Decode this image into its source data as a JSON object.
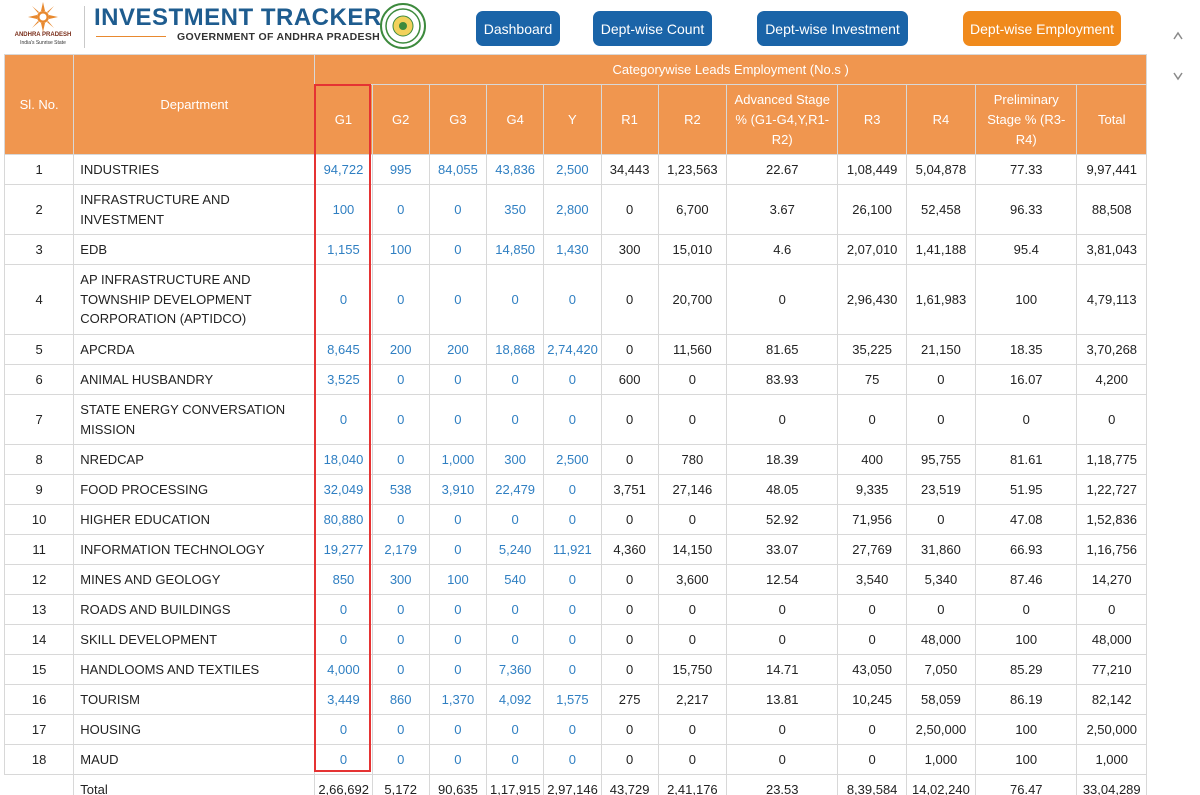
{
  "logo": {
    "state_name": "ANDHRA PRADESH",
    "tagline": "India's Sunrise State"
  },
  "header": {
    "title": "INVESTMENT TRACKER",
    "subtitle": "GOVERNMENT OF ANDHRA PRADESH"
  },
  "nav": [
    {
      "label": "Dashboard",
      "active": false
    },
    {
      "label": "Dept-wise Count",
      "active": false
    },
    {
      "label": "Dept-wise Investment",
      "active": false
    },
    {
      "label": "Dept-wise Employment",
      "active": true
    }
  ],
  "colors": {
    "header_orange": "#f0964f",
    "nav_blue": "#1a64a8",
    "nav_active": "#f08a1c",
    "link_blue": "#2f7fc2",
    "highlight_red": "#e53333",
    "title_blue": "#1e5c8f"
  },
  "table": {
    "group_header": "Categorywise Leads Employment (No.s )",
    "col_slno": "Sl. No.",
    "col_department": "Department",
    "columns": [
      "G1",
      "G2",
      "G3",
      "G4",
      "Y",
      "R1",
      "R2",
      "Advanced Stage % (G1-G4,Y,R1-R2)",
      "R3",
      "R4",
      "Preliminary Stage % (R3-R4)",
      "Total"
    ],
    "rows": [
      {
        "sl": "1",
        "dept": "INDUSTRIES",
        "values": [
          "94,722",
          "995",
          "84,055",
          "43,836",
          "2,500",
          "34,443",
          "1,23,563",
          "22.67",
          "1,08,449",
          "5,04,878",
          "77.33",
          "9,97,441"
        ]
      },
      {
        "sl": "2",
        "dept": "INFRASTRUCTURE AND INVESTMENT",
        "values": [
          "100",
          "0",
          "0",
          "350",
          "2,800",
          "0",
          "6,700",
          "3.67",
          "26,100",
          "52,458",
          "96.33",
          "88,508"
        ]
      },
      {
        "sl": "3",
        "dept": "EDB",
        "values": [
          "1,155",
          "100",
          "0",
          "14,850",
          "1,430",
          "300",
          "15,010",
          "4.6",
          "2,07,010",
          "1,41,188",
          "95.4",
          "3,81,043"
        ]
      },
      {
        "sl": "4",
        "dept": "AP INFRASTRUCTURE AND TOWNSHIP DEVELOPMENT CORPORATION (APTIDCO)",
        "values": [
          "0",
          "0",
          "0",
          "0",
          "0",
          "0",
          "20,700",
          "0",
          "2,96,430",
          "1,61,983",
          "100",
          "4,79,113"
        ]
      },
      {
        "sl": "5",
        "dept": "APCRDA",
        "values": [
          "8,645",
          "200",
          "200",
          "18,868",
          "2,74,420",
          "0",
          "11,560",
          "81.65",
          "35,225",
          "21,150",
          "18.35",
          "3,70,268"
        ]
      },
      {
        "sl": "6",
        "dept": "ANIMAL HUSBANDRY",
        "values": [
          "3,525",
          "0",
          "0",
          "0",
          "0",
          "600",
          "0",
          "83.93",
          "75",
          "0",
          "16.07",
          "4,200"
        ]
      },
      {
        "sl": "7",
        "dept": "STATE ENERGY CONVERSATION MISSION",
        "values": [
          "0",
          "0",
          "0",
          "0",
          "0",
          "0",
          "0",
          "0",
          "0",
          "0",
          "0",
          "0"
        ]
      },
      {
        "sl": "8",
        "dept": "NREDCAP",
        "values": [
          "18,040",
          "0",
          "1,000",
          "300",
          "2,500",
          "0",
          "780",
          "18.39",
          "400",
          "95,755",
          "81.61",
          "1,18,775"
        ]
      },
      {
        "sl": "9",
        "dept": "FOOD PROCESSING",
        "values": [
          "32,049",
          "538",
          "3,910",
          "22,479",
          "0",
          "3,751",
          "27,146",
          "48.05",
          "9,335",
          "23,519",
          "51.95",
          "1,22,727"
        ]
      },
      {
        "sl": "10",
        "dept": "HIGHER EDUCATION",
        "values": [
          "80,880",
          "0",
          "0",
          "0",
          "0",
          "0",
          "0",
          "52.92",
          "71,956",
          "0",
          "47.08",
          "1,52,836"
        ]
      },
      {
        "sl": "11",
        "dept": "INFORMATION TECHNOLOGY",
        "values": [
          "19,277",
          "2,179",
          "0",
          "5,240",
          "11,921",
          "4,360",
          "14,150",
          "33.07",
          "27,769",
          "31,860",
          "66.93",
          "1,16,756"
        ]
      },
      {
        "sl": "12",
        "dept": "MINES AND GEOLOGY",
        "values": [
          "850",
          "300",
          "100",
          "540",
          "0",
          "0",
          "3,600",
          "12.54",
          "3,540",
          "5,340",
          "87.46",
          "14,270"
        ]
      },
      {
        "sl": "13",
        "dept": "ROADS AND BUILDINGS",
        "values": [
          "0",
          "0",
          "0",
          "0",
          "0",
          "0",
          "0",
          "0",
          "0",
          "0",
          "0",
          "0"
        ]
      },
      {
        "sl": "14",
        "dept": "SKILL DEVELOPMENT",
        "values": [
          "0",
          "0",
          "0",
          "0",
          "0",
          "0",
          "0",
          "0",
          "0",
          "48,000",
          "100",
          "48,000"
        ]
      },
      {
        "sl": "15",
        "dept": "HANDLOOMS AND TEXTILES",
        "values": [
          "4,000",
          "0",
          "0",
          "7,360",
          "0",
          "0",
          "15,750",
          "14.71",
          "43,050",
          "7,050",
          "85.29",
          "77,210"
        ]
      },
      {
        "sl": "16",
        "dept": "TOURISM",
        "values": [
          "3,449",
          "860",
          "1,370",
          "4,092",
          "1,575",
          "275",
          "2,217",
          "13.81",
          "10,245",
          "58,059",
          "86.19",
          "82,142"
        ]
      },
      {
        "sl": "17",
        "dept": "HOUSING",
        "values": [
          "0",
          "0",
          "0",
          "0",
          "0",
          "0",
          "0",
          "0",
          "0",
          "2,50,000",
          "100",
          "2,50,000"
        ]
      },
      {
        "sl": "18",
        "dept": "MAUD",
        "values": [
          "0",
          "0",
          "0",
          "0",
          "0",
          "0",
          "0",
          "0",
          "0",
          "1,000",
          "100",
          "1,000"
        ]
      }
    ],
    "total": {
      "label": "Total",
      "values": [
        "2,66,692",
        "5,172",
        "90,635",
        "1,17,915",
        "2,97,146",
        "43,729",
        "2,41,176",
        "23.53",
        "8,39,584",
        "14,02,240",
        "76.47",
        "33,04,289"
      ]
    }
  }
}
